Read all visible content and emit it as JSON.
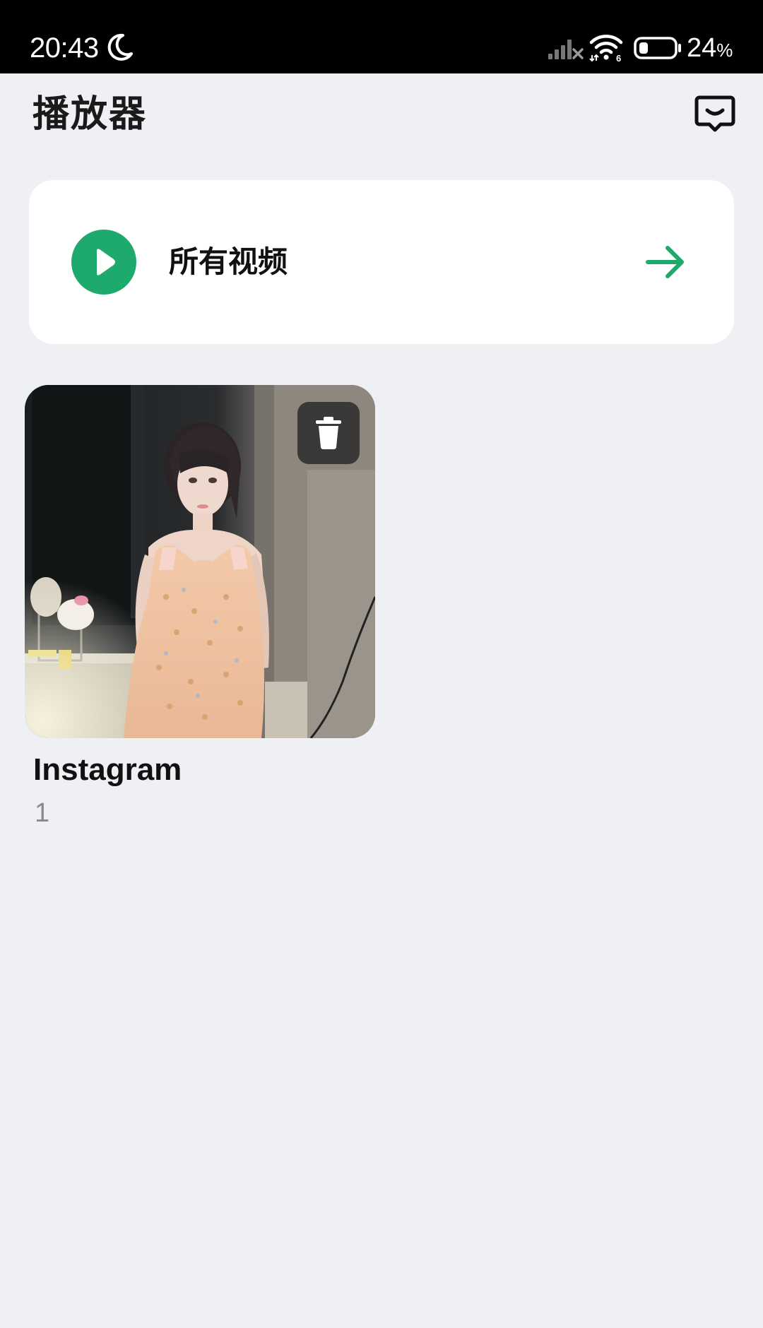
{
  "status_bar": {
    "time": "20:43",
    "battery_level": "24",
    "battery_unit": "%",
    "icons": [
      "moon-icon",
      "signal-icon",
      "wifi-icon",
      "battery-icon"
    ]
  },
  "header": {
    "title": "播放器",
    "feedback_icon": "feedback-icon"
  },
  "all_videos": {
    "label": "所有视频",
    "play_icon": "play-icon",
    "arrow_icon": "arrow-right-icon",
    "accent_color": "#1eaa6c"
  },
  "folders": [
    {
      "name": "Instagram",
      "count": "1",
      "delete_icon": "trash-icon"
    }
  ],
  "colors": {
    "background": "#eff0f4",
    "card": "#ffffff",
    "accent": "#1eaa6c",
    "status_bar": "#000000",
    "count_text": "#8a8a8a"
  }
}
